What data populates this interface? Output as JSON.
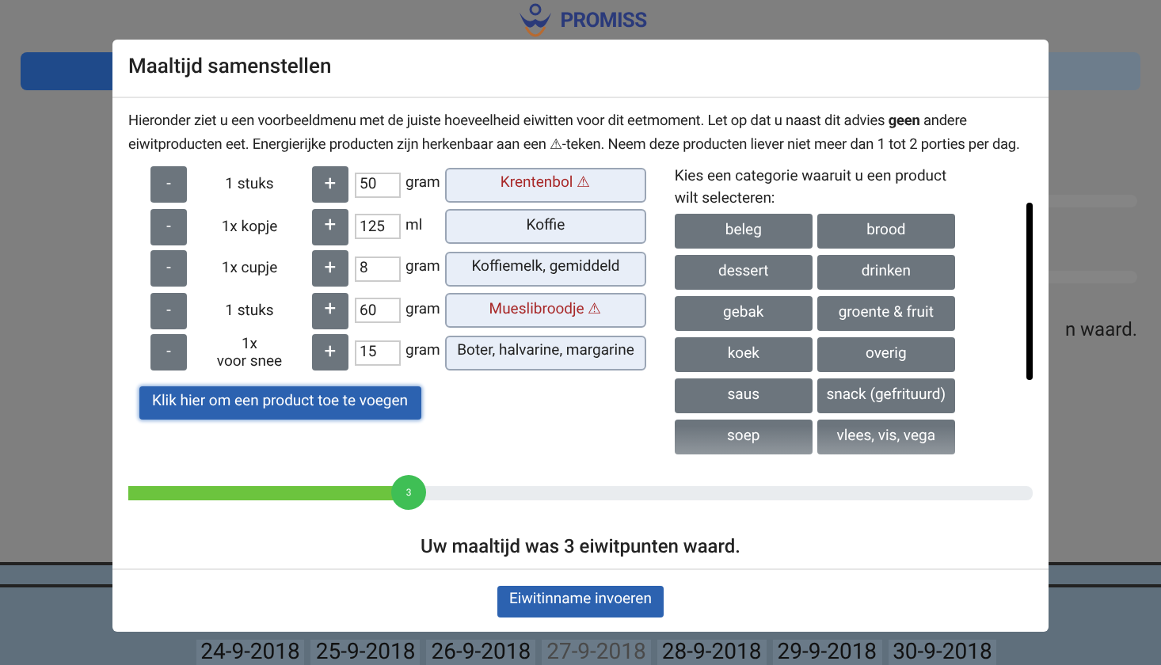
{
  "background": {
    "logo": {
      "name": "PROMISS"
    },
    "partial_text": "n waard.",
    "dates": [
      {
        "label": "24-9-2018",
        "disabled": false
      },
      {
        "label": "25-9-2018",
        "disabled": false
      },
      {
        "label": "26-9-2018",
        "disabled": false
      },
      {
        "label": "27-9-2018",
        "disabled": true
      },
      {
        "label": "28-9-2018",
        "disabled": false
      },
      {
        "label": "29-9-2018",
        "disabled": false
      },
      {
        "label": "30-9-2018",
        "disabled": false
      }
    ]
  },
  "dialog": {
    "title": "Maaltijd samenstellen",
    "intro": "Hieronder ziet u een voorbeeldmenu met de juiste hoeveelheid eiwitten voor dit eetmoment. Let op dat u naast dit advies **geen** andere eiwitproducten eet. Energierijke producten zijn herkenbaar aan een ⚠-teken. Neem deze producten liever niet meer dan 1 tot 2 porties per dag.",
    "items": [
      {
        "minus": "-",
        "portion": "1 stuks",
        "plus": "+",
        "amount": "50",
        "unit": "gram",
        "product": "Krentenbol ⚠",
        "warning": true
      },
      {
        "minus": "-",
        "portion": "1x kopje",
        "plus": "+",
        "amount": "125",
        "unit": "ml",
        "product": "Koffie",
        "warning": false
      },
      {
        "minus": "-",
        "portion": "1x cupje",
        "plus": "+",
        "amount": "8",
        "unit": "gram",
        "product": "Koffiemelk, gemiddeld",
        "warning": false
      },
      {
        "minus": "-",
        "portion": "1 stuks",
        "plus": "+",
        "amount": "60",
        "unit": "gram",
        "product": "Mueslibroodje ⚠",
        "warning": true
      },
      {
        "minus": "-",
        "portion": "1x\nvoor snee",
        "plus": "+",
        "amount": "15",
        "unit": "gram",
        "product": "Boter, halvarine, margarine",
        "warning": false
      }
    ],
    "add_button": "Klik hier om een product toe te voegen",
    "category_prompt": "Kies een categorie waaruit u een product wilt selecteren:",
    "categories": [
      "beleg",
      "brood",
      "dessert",
      "drinken",
      "gebak",
      "groente & fruit",
      "koek",
      "overig",
      "saus",
      "snack (gefrituurd)",
      "soep",
      "vlees, vis, vega"
    ],
    "slider": {
      "level": 0.31,
      "label": "3"
    },
    "result": "Uw maaltijd was 3 eiwitpunten waard.",
    "submit": "Eiwitinname invoeren"
  }
}
